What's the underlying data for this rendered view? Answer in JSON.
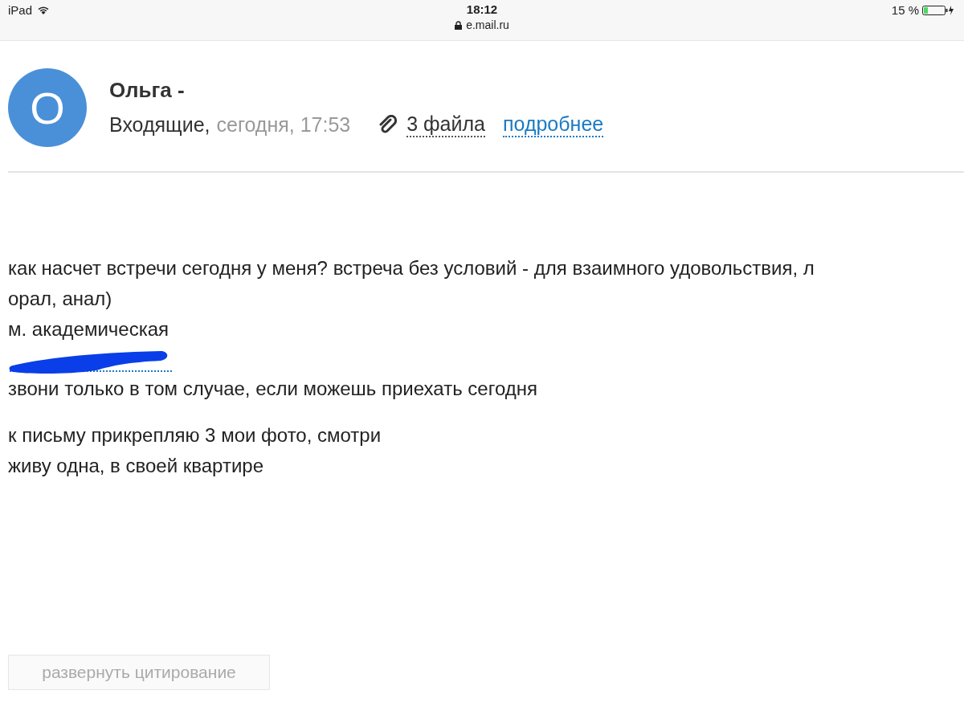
{
  "status_bar": {
    "device": "iPad",
    "time": "18:12",
    "url": "e.mail.ru",
    "battery": "15 %"
  },
  "message": {
    "avatar_letter": "O",
    "sender": "Ольга -",
    "folder": "Входящие,",
    "date": "сегодня, 17:53",
    "attachments": "3 файла",
    "details_link": "подробнее",
    "paragraphs": [
      {
        "kind": "text",
        "lines": [
          "как насчет встречи сегодня у меня? встреча без условий - для взаимного удовольствия, л",
          "орал, анал)",
          "м. академическая"
        ]
      },
      {
        "kind": "redacted_phone"
      },
      {
        "kind": "text",
        "lines": [
          "звони только в том случае, если можешь приехать сегодня"
        ]
      },
      {
        "kind": "text",
        "lines": [
          "к письму прикрепляю 3 мои фото, смотри",
          "живу одна, в своей квартире"
        ]
      }
    ],
    "expand_quote_button": "развернуть цитирование"
  }
}
